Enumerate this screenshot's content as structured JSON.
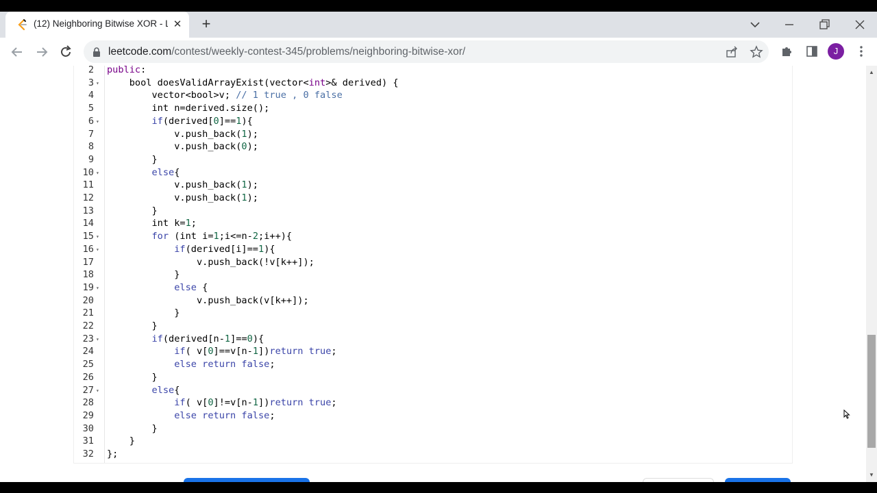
{
  "browser": {
    "tab_title": "(12) Neighboring Bitwise XOR - L",
    "url_host": "leetcode.com",
    "url_path": "/contest/weekly-contest-345/problems/neighboring-bitwise-xor/",
    "avatar_initial": "J",
    "accent": "#7b1fa2"
  },
  "editor": {
    "lines": [
      {
        "n": "2",
        "fold": "",
        "html": "<span class=\"kw\">public</span>:"
      },
      {
        "n": "3",
        "fold": "▾",
        "html": "    bool doesValidArrayExist(vector&lt;<span class=\"kw\">int</span>&gt;&amp; derived) {"
      },
      {
        "n": "4",
        "fold": "",
        "html": "        vector&lt;bool&gt;v; <span class=\"cm\">// 1 true , 0 false</span>"
      },
      {
        "n": "5",
        "fold": "",
        "html": "        int n=derived.size();"
      },
      {
        "n": "6",
        "fold": "▾",
        "html": "        <span class=\"kw2\">if</span>(derived[<span class=\"num\">0</span>]==<span class=\"num\">1</span>){"
      },
      {
        "n": "7",
        "fold": "",
        "html": "            v.push_back(<span class=\"num\">1</span>);"
      },
      {
        "n": "8",
        "fold": "",
        "html": "            v.push_back(<span class=\"num\">0</span>);"
      },
      {
        "n": "9",
        "fold": "",
        "html": "        }"
      },
      {
        "n": "10",
        "fold": "▾",
        "html": "        <span class=\"kw2\">else</span>{"
      },
      {
        "n": "11",
        "fold": "",
        "html": "            v.push_back(<span class=\"num\">1</span>);"
      },
      {
        "n": "12",
        "fold": "",
        "html": "            v.push_back(<span class=\"num\">1</span>);"
      },
      {
        "n": "13",
        "fold": "",
        "html": "        }"
      },
      {
        "n": "14",
        "fold": "",
        "html": "        int k=<span class=\"num\">1</span>;"
      },
      {
        "n": "15",
        "fold": "▾",
        "html": "        <span class=\"kw2\">for</span> (int i=<span class=\"num\">1</span>;i&lt;=n-<span class=\"num\">2</span>;i++){"
      },
      {
        "n": "16",
        "fold": "▾",
        "html": "            <span class=\"kw2\">if</span>(derived[i]==<span class=\"num\">1</span>){"
      },
      {
        "n": "17",
        "fold": "",
        "html": "                v.push_back(!v[k++]);"
      },
      {
        "n": "18",
        "fold": "",
        "html": "            }"
      },
      {
        "n": "19",
        "fold": "▾",
        "html": "            <span class=\"kw2\">else</span> {"
      },
      {
        "n": "20",
        "fold": "",
        "html": "                v.push_back(v[k++]);"
      },
      {
        "n": "21",
        "fold": "",
        "html": "            }"
      },
      {
        "n": "22",
        "fold": "",
        "html": "        }"
      },
      {
        "n": "23",
        "fold": "▾",
        "html": "        <span class=\"kw2\">if</span>(derived[n-<span class=\"num\">1</span>]==<span class=\"num\">0</span>){"
      },
      {
        "n": "24",
        "fold": "",
        "html": "            <span class=\"kw2\">if</span>( v[<span class=\"num\">0</span>]==v[n-<span class=\"num\">1</span>])<span class=\"kw2\">return true</span>;"
      },
      {
        "n": "25",
        "fold": "",
        "html": "            <span class=\"kw2\">else return false</span>;"
      },
      {
        "n": "26",
        "fold": "",
        "html": "        }"
      },
      {
        "n": "27",
        "fold": "▾",
        "html": "        <span class=\"kw2\">else</span>{"
      },
      {
        "n": "28",
        "fold": "",
        "html": "            <span class=\"kw2\">if</span>( v[<span class=\"num\">0</span>]!=v[n-<span class=\"num\">1</span>])<span class=\"kw2\">return true</span>;"
      },
      {
        "n": "29",
        "fold": "",
        "html": "            <span class=\"kw2\">else return false</span>;"
      },
      {
        "n": "30",
        "fold": "",
        "html": "        }"
      },
      {
        "n": "31",
        "fold": "",
        "html": "    }"
      },
      {
        "n": "32",
        "fold": "",
        "html": "};"
      }
    ]
  }
}
